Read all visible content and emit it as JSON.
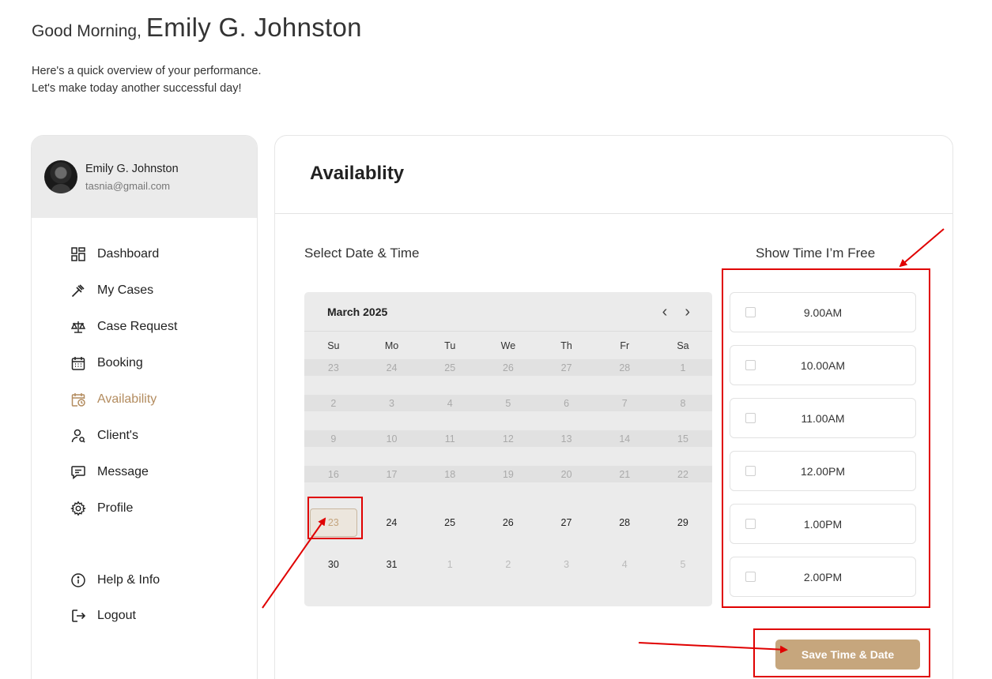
{
  "greeting": {
    "hello": "Good Morning,",
    "name": "Emily G. Johnston"
  },
  "subtitle": {
    "line1": "Here's a quick overview of your performance.",
    "line2": "Let's make today another successful day!"
  },
  "profile": {
    "name": "Emily G. Johnston",
    "email": "tasnia@gmail.com"
  },
  "nav": {
    "items": [
      {
        "label": "Dashboard",
        "icon": "dashboard-icon"
      },
      {
        "label": "My Cases",
        "icon": "gavel-icon"
      },
      {
        "label": "Case Request",
        "icon": "scales-icon"
      },
      {
        "label": "Booking",
        "icon": "calendar-icon"
      },
      {
        "label": "Availability",
        "icon": "calendar-clock-icon",
        "active": true
      },
      {
        "label": "Client's",
        "icon": "user-search-icon"
      },
      {
        "label": "Message",
        "icon": "message-icon"
      },
      {
        "label": "Profile",
        "icon": "gear-icon"
      }
    ],
    "bottom": [
      {
        "label": "Help & Info",
        "icon": "info-icon"
      },
      {
        "label": "Logout",
        "icon": "logout-icon"
      }
    ]
  },
  "panel": {
    "title": "Availablity",
    "select_label": "Select Date & Time",
    "free_label": "Show Time I’m Free"
  },
  "calendar": {
    "month": "March 2025",
    "prev": "‹",
    "next": "›",
    "days": [
      "Su",
      "Mo",
      "Tu",
      "We",
      "Th",
      "Fr",
      "Sa"
    ],
    "weeks": [
      [
        "23",
        "24",
        "25",
        "26",
        "27",
        "28",
        "1"
      ],
      [
        "2",
        "3",
        "4",
        "5",
        "6",
        "7",
        "8"
      ],
      [
        "9",
        "10",
        "11",
        "12",
        "13",
        "14",
        "15"
      ],
      [
        "16",
        "17",
        "18",
        "19",
        "20",
        "21",
        "22"
      ],
      [
        "23",
        "24",
        "25",
        "26",
        "27",
        "28",
        "29"
      ],
      [
        "30",
        "31",
        "1",
        "2",
        "3",
        "4",
        "5"
      ]
    ],
    "selected": "23"
  },
  "slots": [
    "9.00AM",
    "10.00AM",
    "11.00AM",
    "12.00PM",
    "1.00PM",
    "2.00PM"
  ],
  "save_label": "Save Time & Date",
  "colors": {
    "accent": "#c6a67d",
    "annotation": "#e00000",
    "active_nav": "#b38c5f"
  }
}
